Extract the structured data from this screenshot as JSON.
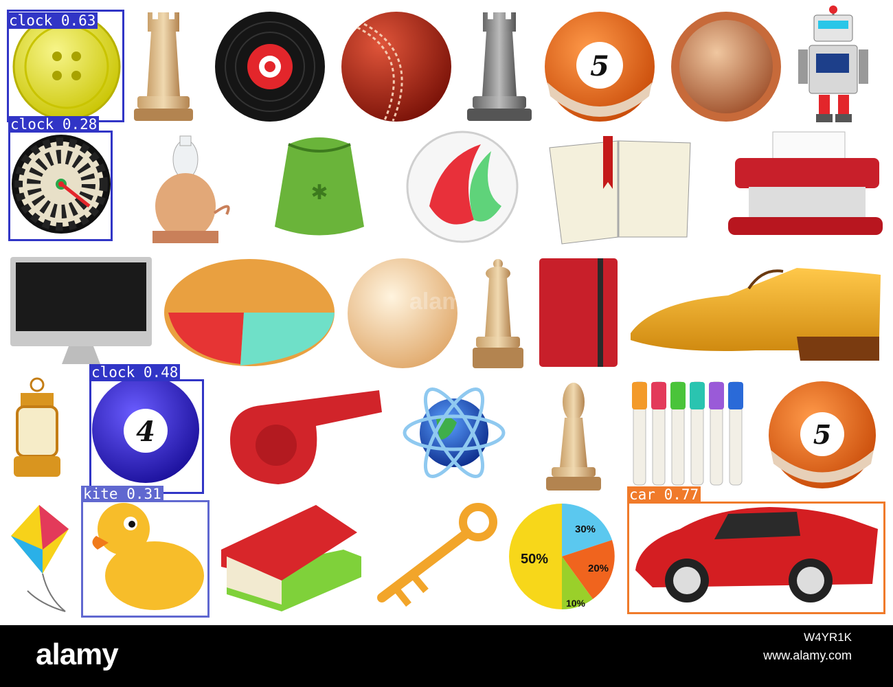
{
  "detections": [
    {
      "label": "clock 0.63",
      "color": "#3135c6"
    },
    {
      "label": "clock 0.28",
      "color": "#3135c6"
    },
    {
      "label": "clock 0.48",
      "color": "#3135c6"
    },
    {
      "label": "kite 0.31",
      "color": "#6068d0"
    },
    {
      "label": "car 0.77",
      "color": "#f07a2a"
    }
  ],
  "pie_labels": [
    "50%",
    "30%",
    "20%",
    "10%"
  ],
  "ball_numbers": [
    "5",
    "5",
    "4"
  ],
  "watermark": "alamy",
  "footer": {
    "brand": "alamy",
    "image_id": "W4YR1K",
    "link": "www.alamy.com"
  }
}
